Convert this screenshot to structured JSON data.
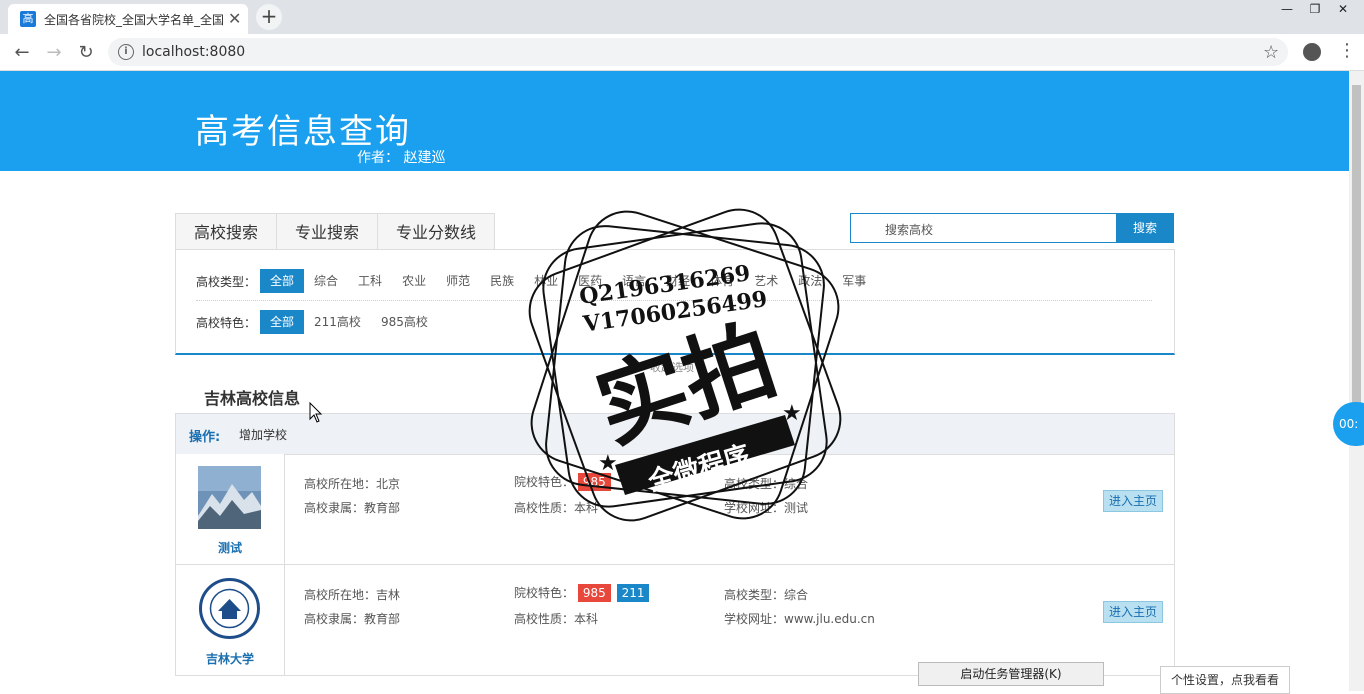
{
  "browser": {
    "tab_favicon": "高",
    "tab_title": "全国各省院校_全国大学名单_全国",
    "tab_close": "✕",
    "new_tab": "+",
    "url": "localhost:8080",
    "win_minimize": "—",
    "win_restore": "❐",
    "win_close": "✕"
  },
  "header": {
    "title": "高考信息查询",
    "author": "作者： 赵建巡",
    "bg_color": "#1aa0ee"
  },
  "filter_tabs": [
    "高校搜索",
    "专业搜索",
    "专业分数线"
  ],
  "search": {
    "placeholder": "搜索高校",
    "button": "搜索"
  },
  "filters": {
    "type_label": "高校类型：",
    "types": [
      "全部",
      "综合",
      "工科",
      "农业",
      "师范",
      "民族",
      "林业",
      "医药",
      "语言",
      "财经",
      "体育",
      "艺术",
      "政法",
      "军事"
    ],
    "feature_label": "高校特色：",
    "features": [
      "全部",
      "211高校",
      "985高校"
    ],
    "collapse": "收起选项"
  },
  "section": {
    "title": "吉林高校信息",
    "ops_label": "操作:",
    "ops_add": "增加学校"
  },
  "schools": [
    {
      "name": "测试",
      "location": "高校所在地：北京",
      "affiliation": "高校隶属：教育部",
      "feature_label": "院校特色：",
      "badges": [
        "985"
      ],
      "nature": "高校性质：本科",
      "type": "高校类型：综合",
      "website": "学校网址：测试",
      "enter": "进入主页"
    },
    {
      "name": "吉林大学",
      "location": "高校所在地：吉林",
      "affiliation": "高校隶属：教育部",
      "feature_label": "院校特色：",
      "badges": [
        "985",
        "211"
      ],
      "nature": "高校性质：本科",
      "type": "高校类型：综合",
      "website": "学校网址：www.jlu.edu.cn",
      "enter": "进入主页"
    }
  ],
  "overlay": {
    "taskmgr": "启动任务管理器(K)",
    "personal": "个性设置，点我看看",
    "timer": "00:",
    "watermark_line1": "Q2196316269",
    "watermark_line2": "V17060256499",
    "watermark_main": "实拍",
    "watermark_sub": "全微程序"
  },
  "colors": {
    "accent": "#1a87c9",
    "badge985": "#e8473b",
    "badge211": "#1a87c9"
  }
}
